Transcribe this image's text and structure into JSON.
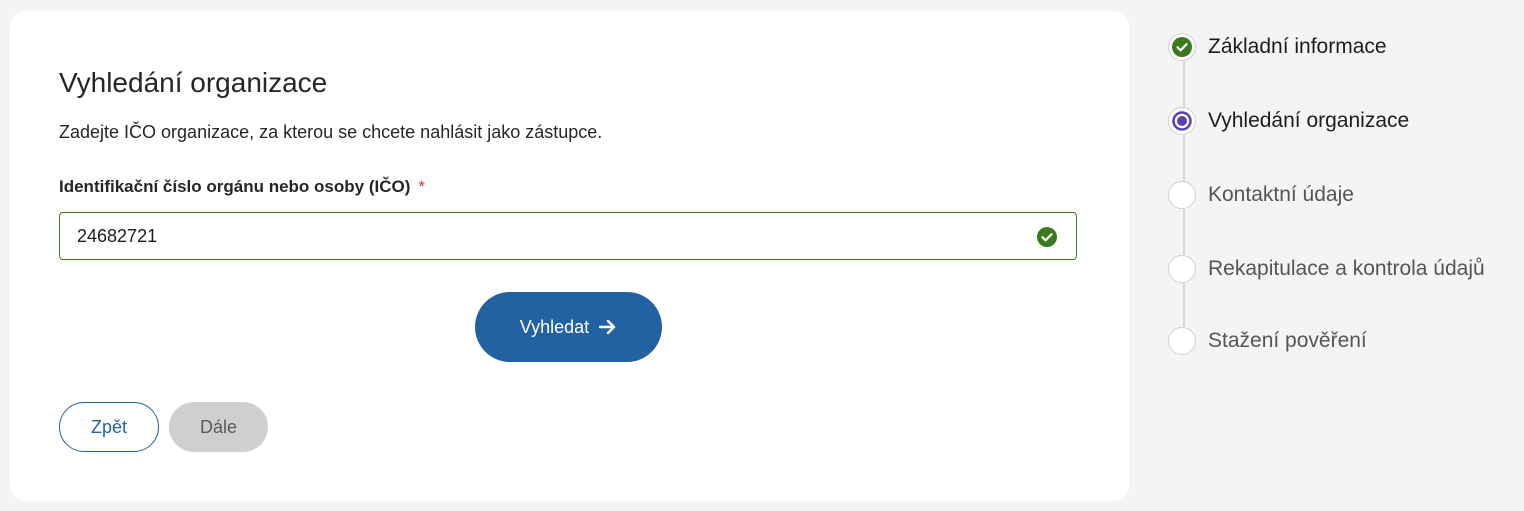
{
  "form": {
    "title": "Vyhledání organizace",
    "description": "Zadejte IČO organizace, za kterou se chcete nahlásit jako zástupce.",
    "field_label": "Identifikační číslo orgánu nebo osoby (IČO)",
    "required_mark": "*",
    "ico_value": "24682721",
    "search_label": "Vyhledat",
    "back_label": "Zpět",
    "next_label": "Dále"
  },
  "stepper": {
    "steps": [
      {
        "label": "Základní informace",
        "state": "done"
      },
      {
        "label": "Vyhledání organizace",
        "state": "current"
      },
      {
        "label": "Kontaktní údaje",
        "state": "todo"
      },
      {
        "label": "Rekapitulace a kontrola údajů",
        "state": "todo"
      },
      {
        "label": "Stažení pověření",
        "state": "todo"
      }
    ]
  },
  "colors": {
    "primary": "#2362a2",
    "success": "#3a7a1f",
    "current_step": "#5b3fb8",
    "disabled": "#cfcfcf"
  },
  "icons": {
    "input_status": "check-circle-icon",
    "search_arrow": "arrow-right-icon"
  }
}
